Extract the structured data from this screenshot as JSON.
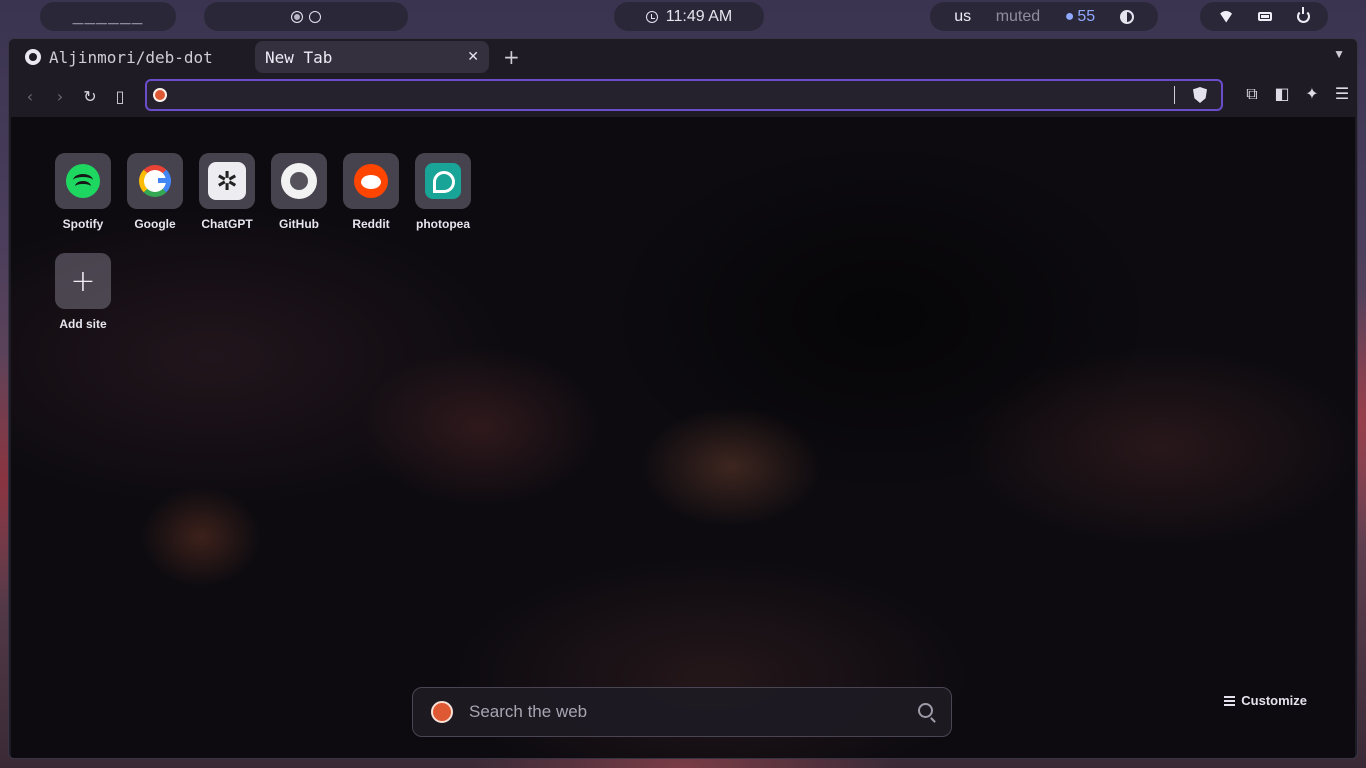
{
  "panel": {
    "workspaces": "______",
    "clock": "11:49 AM",
    "keyboard_layout": "us",
    "volume": "muted",
    "brightness": "55"
  },
  "browser": {
    "tabs": [
      {
        "title": "Aljinmori/deb-dot",
        "icon": "github-icon",
        "active": false
      },
      {
        "title": "New Tab",
        "icon": "",
        "active": true
      }
    ],
    "url": ""
  },
  "newtab": {
    "shortcuts": [
      {
        "label": "Spotify"
      },
      {
        "label": "Google"
      },
      {
        "label": "ChatGPT"
      },
      {
        "label": "GitHub"
      },
      {
        "label": "Reddit"
      },
      {
        "label": "photopea"
      }
    ],
    "add_site_label": "Add site",
    "search_placeholder": "Search the web",
    "customize_label": "Customize"
  },
  "colors": {
    "accent": "#6b4dcc",
    "spotify": "#1ed760",
    "reddit": "#ff4500",
    "photopea": "#18a497",
    "duckduckgo": "#de5833"
  }
}
